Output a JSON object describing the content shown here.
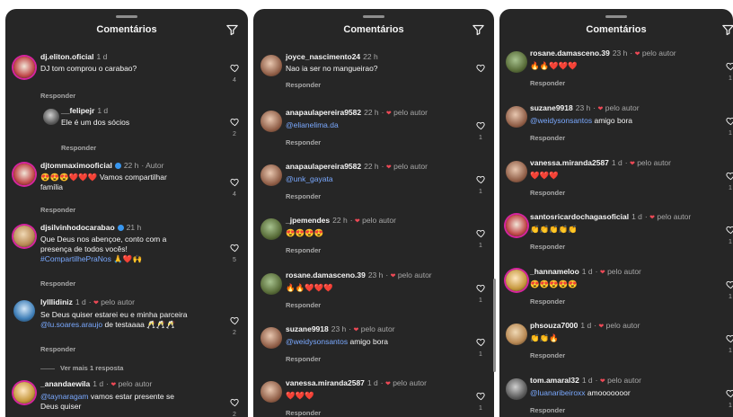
{
  "header_title": "Comentários",
  "reply_label": "Responder",
  "author_label": "Autor",
  "by_author_label": "pelo autor",
  "view_more_replies": "Ver mais 1 resposta",
  "icons": {
    "filter": "filter-icon",
    "like": "heart-outline-icon",
    "liked_by_author": "heart-filled-icon"
  },
  "colors": {
    "background": "#262626",
    "mention": "#7aa9ff",
    "author_heart": "#ed4956"
  },
  "panel1": {
    "c1": {
      "user": "dj.eliton.oficial",
      "time": "1 d",
      "text": "DJ tom comprou o carabao?",
      "likes": "4"
    },
    "c2": {
      "user": "__felipejr",
      "time": "1 d",
      "text": "Ele é um dos sócios",
      "likes": "2"
    },
    "c3": {
      "user": "djtommaximooficial",
      "time": "22 h",
      "text_line1": "😍😍😍❤️❤️❤️ Vamos compartilhar",
      "text_line2": "família",
      "likes": "4"
    },
    "c4": {
      "user": "djsilvinhodocarabao",
      "time": "21 h",
      "text_line1": "Que Deus nos abençoe, conto com a",
      "text_line2": "presença de todos vocês!",
      "hashtag": "#CompartilhePraNos",
      "emoji": "🙏❤️🙌",
      "likes": "5"
    },
    "c5": {
      "user": "lylllidiniz",
      "time": "1 d",
      "text_line1": "Se Deus quiser estarei eu e minha parceira",
      "mention": "@lu.soares.araujo",
      "text_line2": "de testaaaa 🥂🥂🥂",
      "likes": "2"
    },
    "c6": {
      "user": "_anandaewila",
      "time": "1 d",
      "mention": "@taynaragam",
      "text_line1": "vamos estar presente se",
      "text_line2": "Deus quiser",
      "likes": "2"
    }
  },
  "panel2": {
    "c1": {
      "user": "joyce_nascimento24",
      "time": "22 h",
      "text": "Nao ia ser no mangueirao?",
      "likes": ""
    },
    "c2": {
      "user": "anapaulapereira9582",
      "time": "22 h",
      "mention": "@elianelima.da",
      "likes": "1"
    },
    "c3": {
      "user": "anapaulapereira9582",
      "time": "22 h",
      "mention": "@unk_gayata",
      "likes": "1"
    },
    "c4": {
      "user": "_jpemendes",
      "time": "22 h",
      "text": "😍😍😍😍",
      "likes": "1"
    },
    "c5": {
      "user": "rosane.damasceno.39",
      "time": "23 h",
      "text": "🔥🔥❤️❤️❤️",
      "likes": "1"
    },
    "c6": {
      "user": "suzane9918",
      "time": "23 h",
      "mention": "@weidysonsantos",
      "text": "amigo bora",
      "likes": "1"
    },
    "c7": {
      "user": "vanessa.miranda2587",
      "time": "1 d",
      "text": "❤️❤️❤️",
      "likes": "1"
    }
  },
  "panel3": {
    "c1": {
      "user": "rosane.damasceno.39",
      "time": "23 h",
      "text": "🔥🔥❤️❤️❤️",
      "likes": "1"
    },
    "c2": {
      "user": "suzane9918",
      "time": "23 h",
      "mention": "@weidysonsantos",
      "text": "amigo bora",
      "likes": "1"
    },
    "c3": {
      "user": "vanessa.miranda2587",
      "time": "1 d",
      "text": "❤️❤️❤️",
      "likes": "1"
    },
    "c4": {
      "user": "santosricardochagasoficial",
      "time": "1 d",
      "text": "👏👏👏👏👏",
      "likes": "1"
    },
    "c5": {
      "user": "_hannameloo",
      "time": "1 d",
      "text": "😍😍😍😍😍",
      "likes": "1"
    },
    "c6": {
      "user": "phsouza7000",
      "time": "1 d",
      "text": "👏👏🔥",
      "likes": "1"
    },
    "c7": {
      "user": "tom.amaral32",
      "time": "1 d",
      "mention": "@luanaribeiroxx",
      "text": "amooooooor",
      "likes": "1"
    }
  }
}
